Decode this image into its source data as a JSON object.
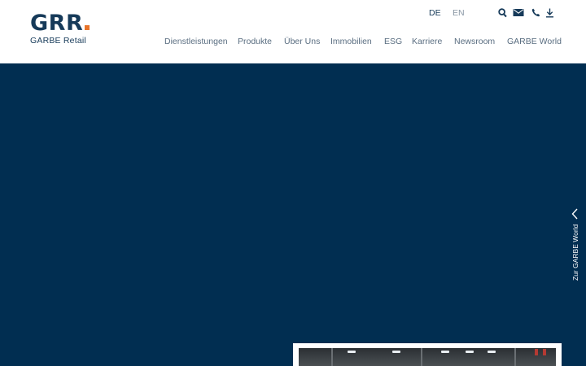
{
  "header": {
    "logo": {
      "mark": "GRR",
      "subtitle": "GARBE Retail",
      "accent_color": "#e8742a",
      "brand_color": "#163a59"
    },
    "languages": [
      {
        "code": "DE",
        "active": true
      },
      {
        "code": "EN",
        "active": false
      }
    ],
    "tools": [
      {
        "icon": "search-icon"
      },
      {
        "icon": "mail-icon"
      },
      {
        "icon": "phone-icon"
      },
      {
        "icon": "download-icon"
      }
    ],
    "nav": [
      {
        "label": "Dienstleistungen"
      },
      {
        "label": "Produkte"
      },
      {
        "label": "Über Uns"
      },
      {
        "label": "Immobilien"
      },
      {
        "label": "ESG"
      },
      {
        "label": "Karriere"
      },
      {
        "label": "Newsroom"
      },
      {
        "label": "GARBE World"
      }
    ]
  },
  "hero": {
    "background_color": "#012e51"
  },
  "side_tab": {
    "label": "Zur GARBE World",
    "icon": "chevron-left-icon"
  }
}
